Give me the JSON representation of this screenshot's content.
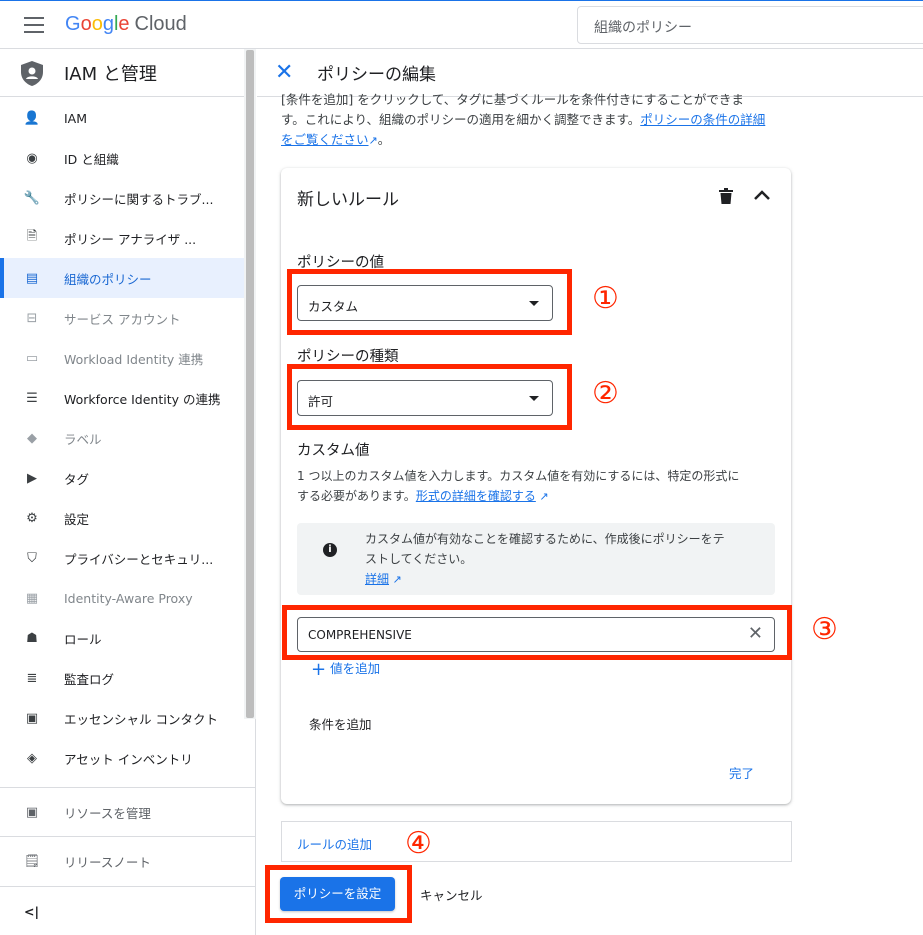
{
  "topbar": {
    "logo_letters": [
      "G",
      "o",
      "o",
      "g",
      "l",
      "e"
    ],
    "logo_suffix": "Cloud",
    "search_placeholder": "組織のポリシー"
  },
  "sidebar": {
    "title": "IAM と管理",
    "items": [
      {
        "label": "IAM",
        "icon": "person-add-icon",
        "glyph": "👤"
      },
      {
        "label": "ID と組織",
        "icon": "account-circle-icon",
        "glyph": "◉"
      },
      {
        "label": "ポリシーに関するトラブ...",
        "icon": "wrench-icon",
        "glyph": "🔧"
      },
      {
        "label": "ポリシー アナライザ ...",
        "icon": "document-search-icon",
        "glyph": "🗎"
      },
      {
        "label": "組織のポリシー",
        "icon": "document-icon",
        "glyph": "▤",
        "active": true
      },
      {
        "label": "サービス アカウント",
        "icon": "service-account-icon",
        "glyph": "⊟",
        "dim": true
      },
      {
        "label": "Workload Identity 連携",
        "icon": "id-card-icon",
        "glyph": "▭",
        "dim": true
      },
      {
        "label": "Workforce Identity の連携",
        "icon": "list-icon",
        "glyph": "☰"
      },
      {
        "label": "ラベル",
        "icon": "label-icon",
        "glyph": "◆",
        "dim": true
      },
      {
        "label": "タグ",
        "icon": "tag-icon",
        "glyph": "▶"
      },
      {
        "label": "設定",
        "icon": "gear-icon",
        "glyph": "⚙"
      },
      {
        "label": "プライバシーとセキュリ...",
        "icon": "shield-icon",
        "glyph": "⛉"
      },
      {
        "label": "Identity-Aware Proxy",
        "icon": "proxy-icon",
        "glyph": "▦",
        "dim": true
      },
      {
        "label": "ロール",
        "icon": "role-hat-icon",
        "glyph": "☗"
      },
      {
        "label": "監査ログ",
        "icon": "audit-log-icon",
        "glyph": "≣"
      },
      {
        "label": "エッセンシャル コンタクト",
        "icon": "contact-icon",
        "glyph": "▣"
      },
      {
        "label": "アセット インベントリ",
        "icon": "asset-inventory-icon",
        "glyph": "◈"
      }
    ],
    "manage_resources": "リソースを管理",
    "release_notes": "リリースノート",
    "collapse_glyph": "<|"
  },
  "panel": {
    "title": "ポリシーの編集",
    "intro_line1": "[条件を追加] をクリックして、タグに基づくルールを条件付きにすることができま",
    "intro_line2": "す。これにより、組織のポリシーの適用を細かく調整できます。",
    "intro_link_a": "ポリシーの条件の詳細",
    "intro_link_b": "をご覧ください",
    "rule": {
      "title": "新しいルール",
      "policy_value_label": "ポリシーの値",
      "policy_value": "カスタム",
      "policy_type_label": "ポリシーの種類",
      "policy_type": "許可",
      "custom_values_label": "カスタム値",
      "custom_desc_line1": "1 つ以上のカスタム値を入力します。カスタム値を有効にするには、特定の形式に",
      "custom_desc_line2": "する必要があります。",
      "custom_desc_link": "形式の詳細を確認する",
      "info_line1": "カスタム値が有効なことを確認するために、作成後にポリシーをテ",
      "info_line2": "ストしてください。",
      "info_link": "詳細",
      "custom_value": "COMPREHENSIVE",
      "add_value": "値を追加",
      "add_condition": "条件を追加",
      "done": "完了"
    },
    "add_rule": "ルールの追加",
    "set_policy": "ポリシーを設定",
    "cancel": "キャンセル"
  },
  "annotations": {
    "marker1": "①",
    "marker2": "②",
    "marker3": "③",
    "marker4": "④",
    "color": "#ff2600"
  }
}
